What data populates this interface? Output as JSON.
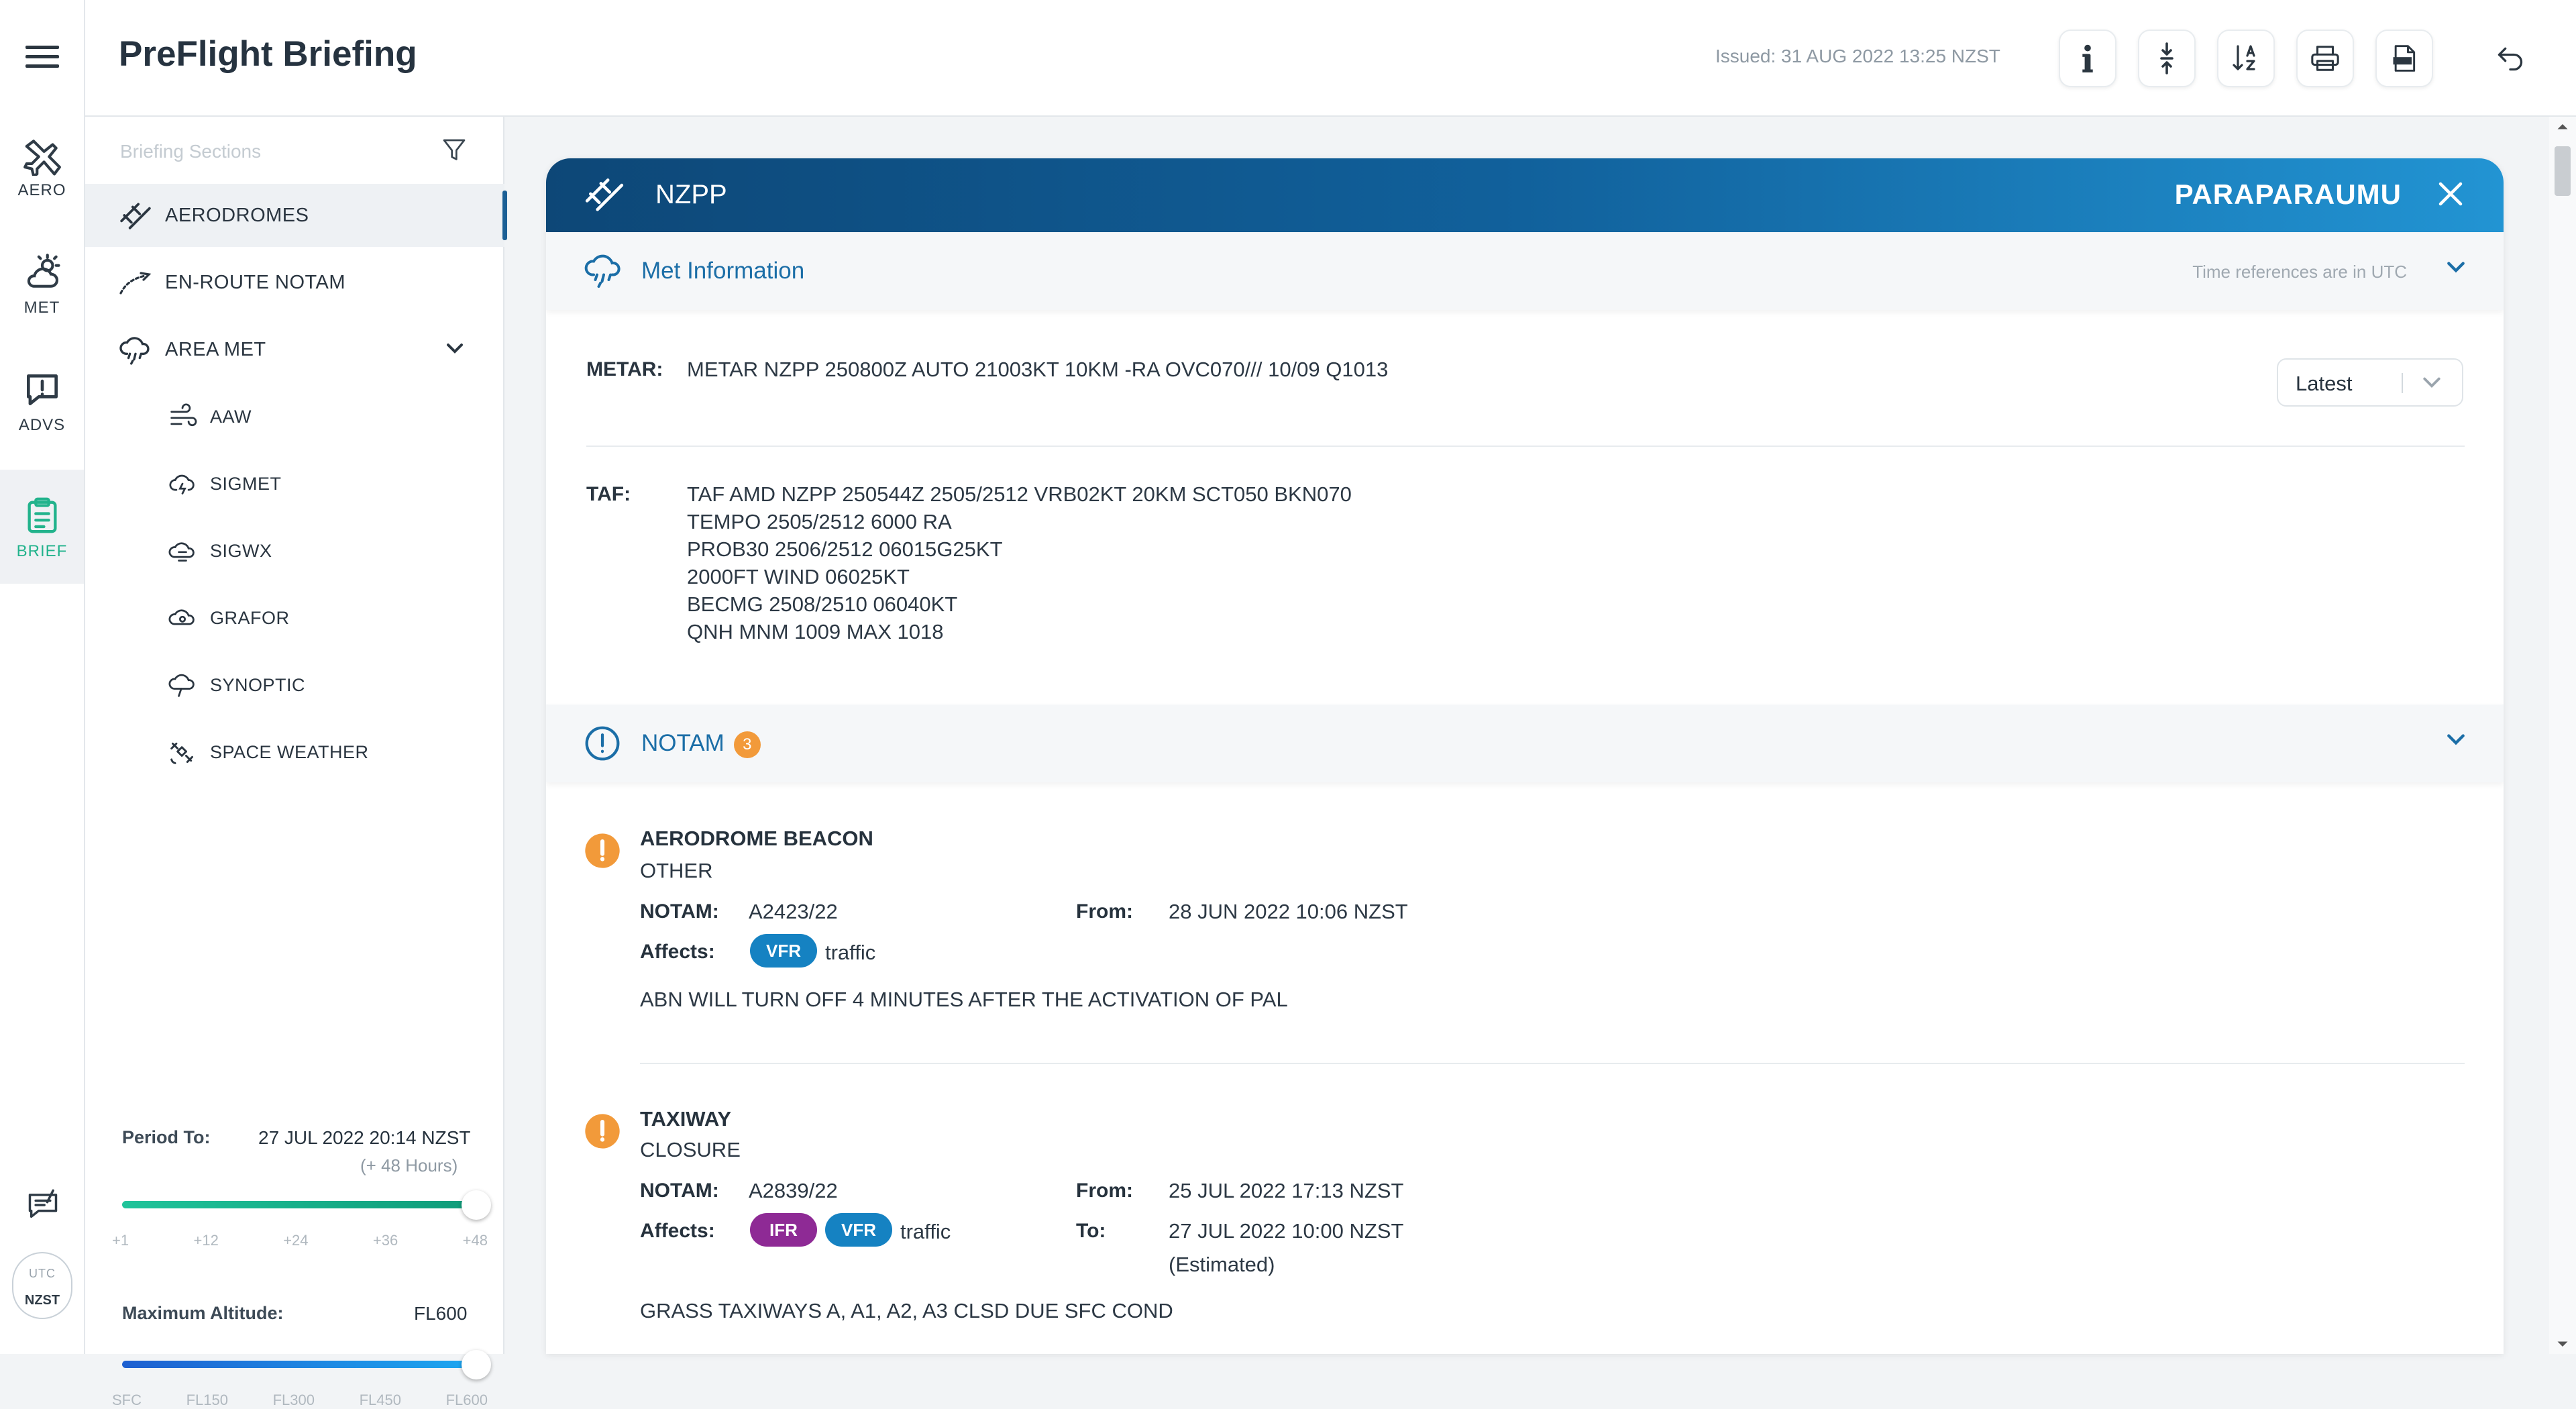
{
  "rail": {
    "items": [
      {
        "label": "AERO",
        "icon": "aero-plane-icon"
      },
      {
        "label": "MET",
        "icon": "weather-cloud-icon"
      },
      {
        "label": "ADVS",
        "icon": "advisory-alert-icon"
      },
      {
        "label": "BRIEF",
        "icon": "clipboard-icon"
      }
    ],
    "active": "BRIEF",
    "tz": {
      "utc": "UTC",
      "nzst": "NZST"
    }
  },
  "header": {
    "title": "PreFlight Briefing",
    "issued": "Issued:  31 AUG 2022 13:25 NZST"
  },
  "sections": {
    "search_placeholder": "Briefing Sections",
    "items": [
      {
        "label": "AERODROMES"
      },
      {
        "label": "EN-ROUTE NOTAM"
      },
      {
        "label": "AREA MET"
      }
    ],
    "sub_items": [
      {
        "label": "AAW"
      },
      {
        "label": "SIGMET"
      },
      {
        "label": "SIGWX"
      },
      {
        "label": "GRAFOR"
      },
      {
        "label": "SYNOPTIC"
      },
      {
        "label": "SPACE WEATHER"
      }
    ],
    "period": {
      "label": "Period To:",
      "value": "27 JUL 2022 20:14 NZST",
      "sub": "(+ 48 Hours)",
      "ticks": [
        "+1",
        "+12",
        "+24",
        "+36",
        "+48"
      ],
      "level": 1.0
    },
    "altitude": {
      "label": "Maximum Altitude:",
      "value": "FL600",
      "ticks": [
        "SFC",
        "FL150",
        "FL300",
        "FL450",
        "FL600"
      ],
      "level": 1.0
    }
  },
  "card": {
    "code": "NZPP",
    "name": "PARAPARAUMU",
    "met": {
      "title": "Met Information",
      "note": "Time references are in UTC",
      "metar_label": "METAR:",
      "metar": "METAR NZPP 250800Z AUTO 21003KT 10KM -RA OVC070/// 10/09 Q1013",
      "select_value": "Latest",
      "taf_label": "TAF:",
      "taf_lines": [
        "TAF AMD NZPP 250544Z 2505/2512 VRB02KT 20KM SCT050 BKN070",
        "TEMPO 2505/2512 6000 RA",
        "PROB30 2506/2512 06015G25KT",
        "2000FT WIND 06025KT",
        "BECMG 2508/2510 06040KT",
        "QNH MNM 1009 MAX 1018"
      ]
    },
    "notam": {
      "title": "NOTAM",
      "count": "3",
      "entries": [
        {
          "title": "AERODROME BEACON",
          "sub": "OTHER",
          "notam_label": "NOTAM:",
          "notam": "A2423/22",
          "from_label": "From:",
          "from": "28 JUN 2022 10:06 NZST",
          "affects_label": "Affects:",
          "tags": [
            "VFR"
          ],
          "traffic": "traffic",
          "text": "ABN WILL TURN OFF 4 MINUTES AFTER THE ACTIVATION OF PAL"
        },
        {
          "title": "TAXIWAY",
          "sub": "CLOSURE",
          "notam_label": "NOTAM:",
          "notam": "A2839/22",
          "from_label": "From:",
          "from": "25 JUL 2022 17:13 NZST",
          "to_label": "To:",
          "to": "27 JUL 2022 10:00 NZST",
          "to_note": "(Estimated)",
          "affects_label": "Affects:",
          "tags": [
            "IFR",
            "VFR"
          ],
          "traffic": "traffic",
          "text": "GRASS TAXIWAYS A, A1, A2, A3 CLSD DUE SFC COND"
        }
      ]
    }
  },
  "colors": {
    "brand_dark": "#0d4777",
    "brand_light": "#2294d3",
    "accent_green": "#22b38c",
    "warning_orange": "#f29a3a",
    "vfr_blue": "#1582c2",
    "ifr_purple": "#8e2a95"
  }
}
